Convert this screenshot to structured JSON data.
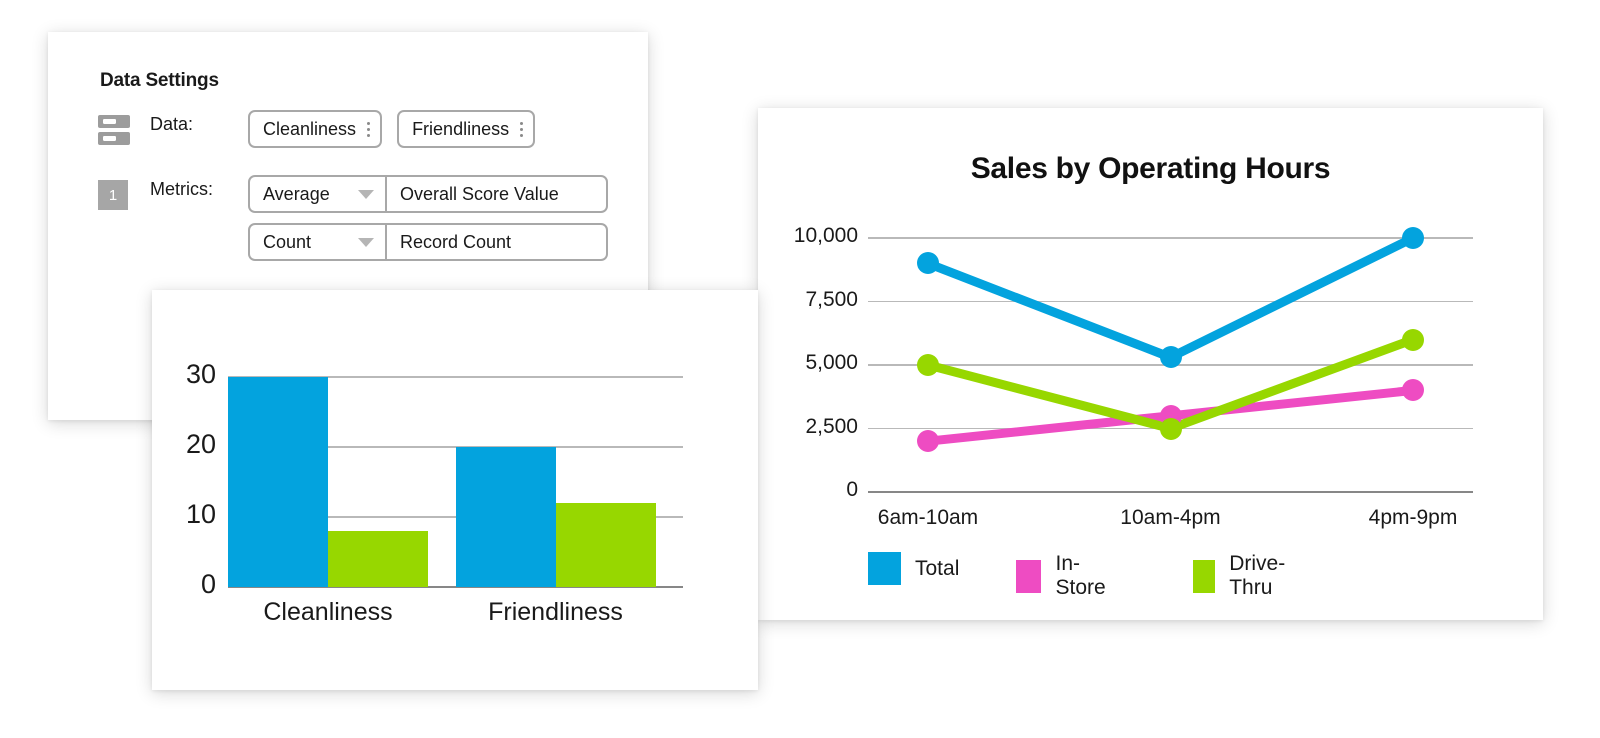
{
  "settings": {
    "title": "Data Settings",
    "data_row": {
      "icon": "server-icon",
      "label": "Data:",
      "pills": [
        {
          "text": "Cleanliness",
          "menu_icon": "kebab-menu-icon"
        },
        {
          "text": "Friendliness",
          "menu_icon": "kebab-menu-icon"
        }
      ]
    },
    "metrics_row": {
      "badge": "1",
      "label": "Metrics:",
      "rows": [
        {
          "aggregation": "Average",
          "caret_icon": "chevron-down-icon",
          "field": "Overall Score Value"
        },
        {
          "aggregation": "Count",
          "caret_icon": "chevron-down-icon",
          "field": "Record Count"
        }
      ]
    }
  },
  "colors": {
    "blue": "#03a3de",
    "pink": "#ee4cc2",
    "green": "#97d700",
    "grid": "#b9b9b9",
    "axis": "#878787",
    "text": "#1a1a1a",
    "border": "#a8a8a8",
    "icon_gray": "#9c9c9c",
    "badge_gray": "#a6a6a6"
  },
  "chart_data": [
    {
      "id": "bar-chart",
      "type": "bar",
      "title": "",
      "categories": [
        "Cleanliness",
        "Friendliness"
      ],
      "series": [
        {
          "name": "Average Overall Score Value",
          "color": "#03a3de",
          "values": [
            30,
            20
          ]
        },
        {
          "name": "Record Count",
          "color": "#97d700",
          "values": [
            8,
            12
          ]
        }
      ],
      "xlabel": "",
      "ylabel": "",
      "ylim": [
        0,
        30
      ],
      "yticks": [
        0,
        10,
        20,
        30
      ],
      "ytick_labels": [
        "0",
        "10",
        "20",
        "30"
      ],
      "grid": true,
      "legend": "none"
    },
    {
      "id": "line-chart",
      "type": "line",
      "title": "Sales by Operating Hours",
      "categories": [
        "6am-10am",
        "10am-4pm",
        "4pm-9pm"
      ],
      "series": [
        {
          "name": "Total",
          "color": "#03a3de",
          "values": [
            9000,
            5300,
            10000
          ]
        },
        {
          "name": "In-Store",
          "color": "#ee4cc2",
          "values": [
            2000,
            3000,
            4000
          ]
        },
        {
          "name": "Drive-Thru",
          "color": "#97d700",
          "values": [
            5000,
            2500,
            6000
          ]
        }
      ],
      "xlabel": "",
      "ylabel": "",
      "ylim": [
        0,
        10000
      ],
      "yticks": [
        0,
        2500,
        5000,
        7500,
        10000
      ],
      "ytick_labels": [
        "0",
        "2,500",
        "5,000",
        "7,500",
        "10,000"
      ],
      "grid": true,
      "legend": "bottom"
    }
  ]
}
